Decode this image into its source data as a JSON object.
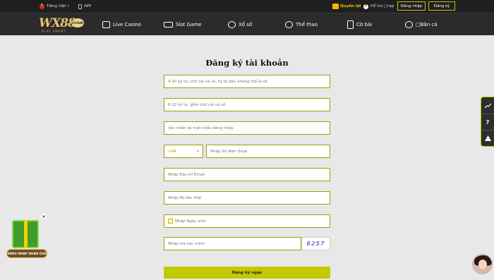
{
  "topbar": {
    "language": "Tiếng Việt",
    "app": "APP",
    "quyenloi": "Quyền lợi",
    "support": "Hỗ trợ □rap",
    "login": "Đăng nhập",
    "register": "Đăng ký"
  },
  "logo": {
    "main": "WX88",
    "badge": "Cclub",
    "sub": "PLAY SMART"
  },
  "nav": {
    "live_casino": "Live Casino",
    "slot_game": "Slot Game",
    "xo_so": "Xổ số",
    "the_thao": "Thể thao",
    "co_bai": "Cờ bài",
    "ban_ca": "□Bắn cá"
  },
  "form": {
    "title": "Đăng ký tài khoản",
    "username_placeholder": "4-20 ký tự, chữ cái và số, ký tự đầu không thể là số",
    "password_placeholder": "6-12 ký tự, gồm chữ cái và số",
    "confirm_placeholder": "Xác nhận lại mật khẩu đăng nhập",
    "phone_prefix": "+84",
    "phone_placeholder": "Nhập Số điện thoại",
    "email_placeholder": "Nhập Địa chỉ Email",
    "fullname_placeholder": "Nhập Họ tên thật",
    "birthday_placeholder": "Nhập Ngày sinh",
    "captcha_placeholder": "Nhập mã xác minh",
    "captcha_code": "8257",
    "submit": "Đăng ký ngay"
  },
  "promo": {
    "label": "ĐĂNG NHẬP NHẬN QUÀ",
    "close": "×"
  },
  "side_tools": [
    "chart-icon",
    "help-icon",
    "arrow-up-icon"
  ],
  "colors": {
    "accent": "#c3c900",
    "topbar": "#1f1f1f",
    "navbar": "#2b2b2b",
    "background": "#e8e8e8"
  }
}
